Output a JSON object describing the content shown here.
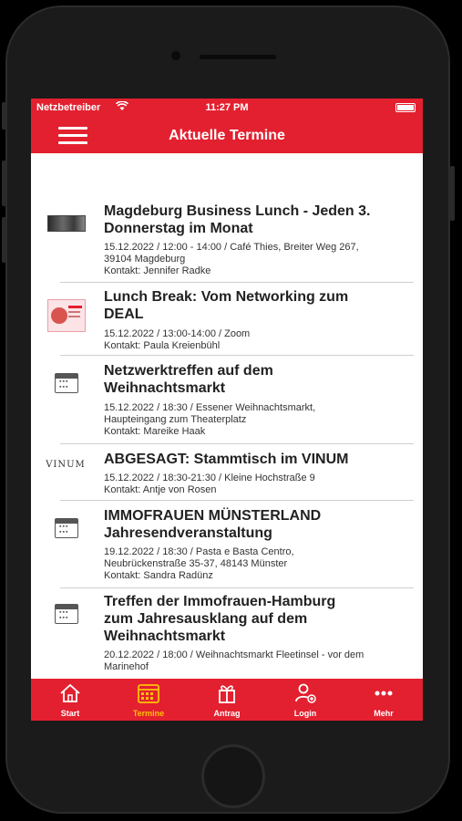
{
  "status": {
    "carrier": "Netzbetreiber",
    "wifi_icon": "wifi-icon",
    "time": "11:27 PM",
    "battery_icon": "battery-icon"
  },
  "header": {
    "title": "Aktuelle Termine",
    "menu_icon": "hamburger-menu-icon",
    "bg_color": "#e3202f"
  },
  "events": [
    {
      "title": "Magdeburg Business Lunch - Jeden 3. Donnerstag im Monat",
      "meta": "15.12.2022 / 12:00 - 14:00 / Café Thies, Breiter Weg 267, 39104 Magdeburg",
      "contact": "Kontakt: Jennifer Radke",
      "thumb": "photo-thumbnail"
    },
    {
      "title": "Lunch Break: Vom Networking zum DEAL",
      "meta": "15.12.2022 / 13:00-14:00 / Zoom",
      "contact": "Kontakt: Paula Kreienbühl",
      "thumb": "flyer-thumbnail"
    },
    {
      "title": "Netzwerktreffen auf dem Weihnachtsmarkt",
      "meta": "15.12.2022 / 18:30 / Essener Weihnachtsmarkt, Haupteingang zum Theaterplatz",
      "contact": "Kontakt: Mareike Haak",
      "thumb": "calendar-icon"
    },
    {
      "title": "ABGESAGT: Stammtisch im VINUM",
      "meta": "15.12.2022 / 18:30-21:30 / Kleine Hochstraße 9",
      "contact": "Kontakt: Antje von Rosen",
      "thumb": "vinum-logo",
      "logo_text": "VINUM"
    },
    {
      "title": "IMMOFRAUEN MÜNSTERLAND Jahresendveranstaltung",
      "meta": "19.12.2022 / 18:30 / Pasta e Basta Centro, Neubrückenstraße 35-37, 48143 Münster",
      "contact": "Kontakt: Sandra Radünz",
      "thumb": "calendar-icon"
    },
    {
      "title": "Treffen der Immofrauen-Hamburg zum Jahresausklang auf dem Weihnachtsmarkt",
      "meta": "20.12.2022 / 18:00 / Weihnachtsmarkt Fleetinsel - vor dem Marinehof",
      "contact": "",
      "thumb": "calendar-icon"
    }
  ],
  "tabs": [
    {
      "label": "Start",
      "icon": "home-icon"
    },
    {
      "label": "Termine",
      "icon": "calendar-icon",
      "active": true
    },
    {
      "label": "Antrag",
      "icon": "gift-icon"
    },
    {
      "label": "Login",
      "icon": "user-add-icon"
    },
    {
      "label": "Mehr",
      "icon": "more-dots-icon"
    }
  ],
  "colors": {
    "accent": "#e3202f",
    "active_tab": "#ffc107"
  }
}
